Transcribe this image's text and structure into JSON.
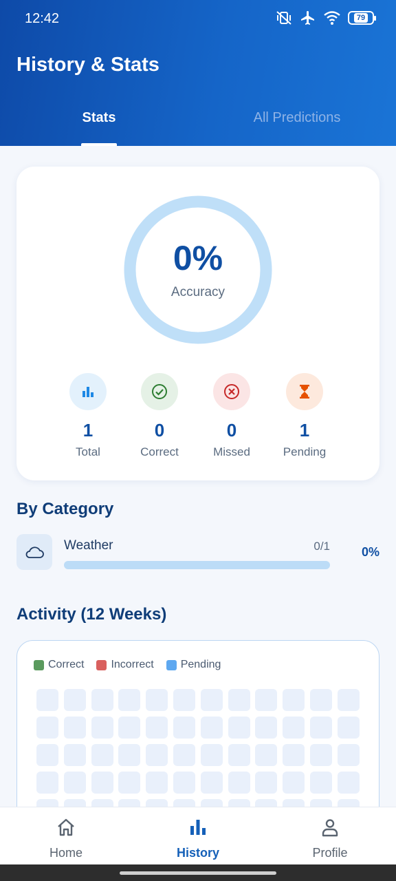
{
  "status_bar": {
    "time": "12:42",
    "battery": "79",
    "icons": [
      "vibrate-off-icon",
      "airplane-icon",
      "wifi-icon",
      "battery-icon"
    ]
  },
  "header": {
    "title": "History & Stats",
    "tabs": [
      {
        "label": "Stats",
        "active": true
      },
      {
        "label": "All Predictions",
        "active": false
      }
    ]
  },
  "accuracy": {
    "value": "0%",
    "label": "Accuracy",
    "fraction": 0
  },
  "stats": [
    {
      "value": "1",
      "label": "Total",
      "icon": "bar-chart-icon",
      "color": "#1e88e5",
      "bg": "#e3f1fc"
    },
    {
      "value": "0",
      "label": "Correct",
      "icon": "check-circle-icon",
      "color": "#2e7d32",
      "bg": "#e5f1e6"
    },
    {
      "value": "0",
      "label": "Missed",
      "icon": "x-circle-icon",
      "color": "#c62828",
      "bg": "#fbe5e5"
    },
    {
      "value": "1",
      "label": "Pending",
      "icon": "hourglass-icon",
      "color": "#e65100",
      "bg": "#fde9dd"
    }
  ],
  "by_category": {
    "title": "By Category",
    "items": [
      {
        "name": "Weather",
        "count": "0/1",
        "percent": "0%",
        "progress": 0,
        "icon": "cloud-icon"
      }
    ]
  },
  "activity": {
    "title": "Activity (12 Weeks)",
    "legend": [
      {
        "label": "Correct",
        "color": "#5a9a5e"
      },
      {
        "label": "Incorrect",
        "color": "#d9605e"
      },
      {
        "label": "Pending",
        "color": "#5ea8f0"
      }
    ]
  },
  "bottom_nav": {
    "items": [
      {
        "label": "Home",
        "icon": "home-icon",
        "active": false
      },
      {
        "label": "History",
        "icon": "bar-chart-icon",
        "active": true
      },
      {
        "label": "Profile",
        "icon": "person-icon",
        "active": false
      }
    ]
  },
  "colors": {
    "header_gradient_start": "#0e4aa8",
    "header_gradient_end": "#1a74d6",
    "accent": "#0f4fa3",
    "ring": "#bfdff8"
  }
}
